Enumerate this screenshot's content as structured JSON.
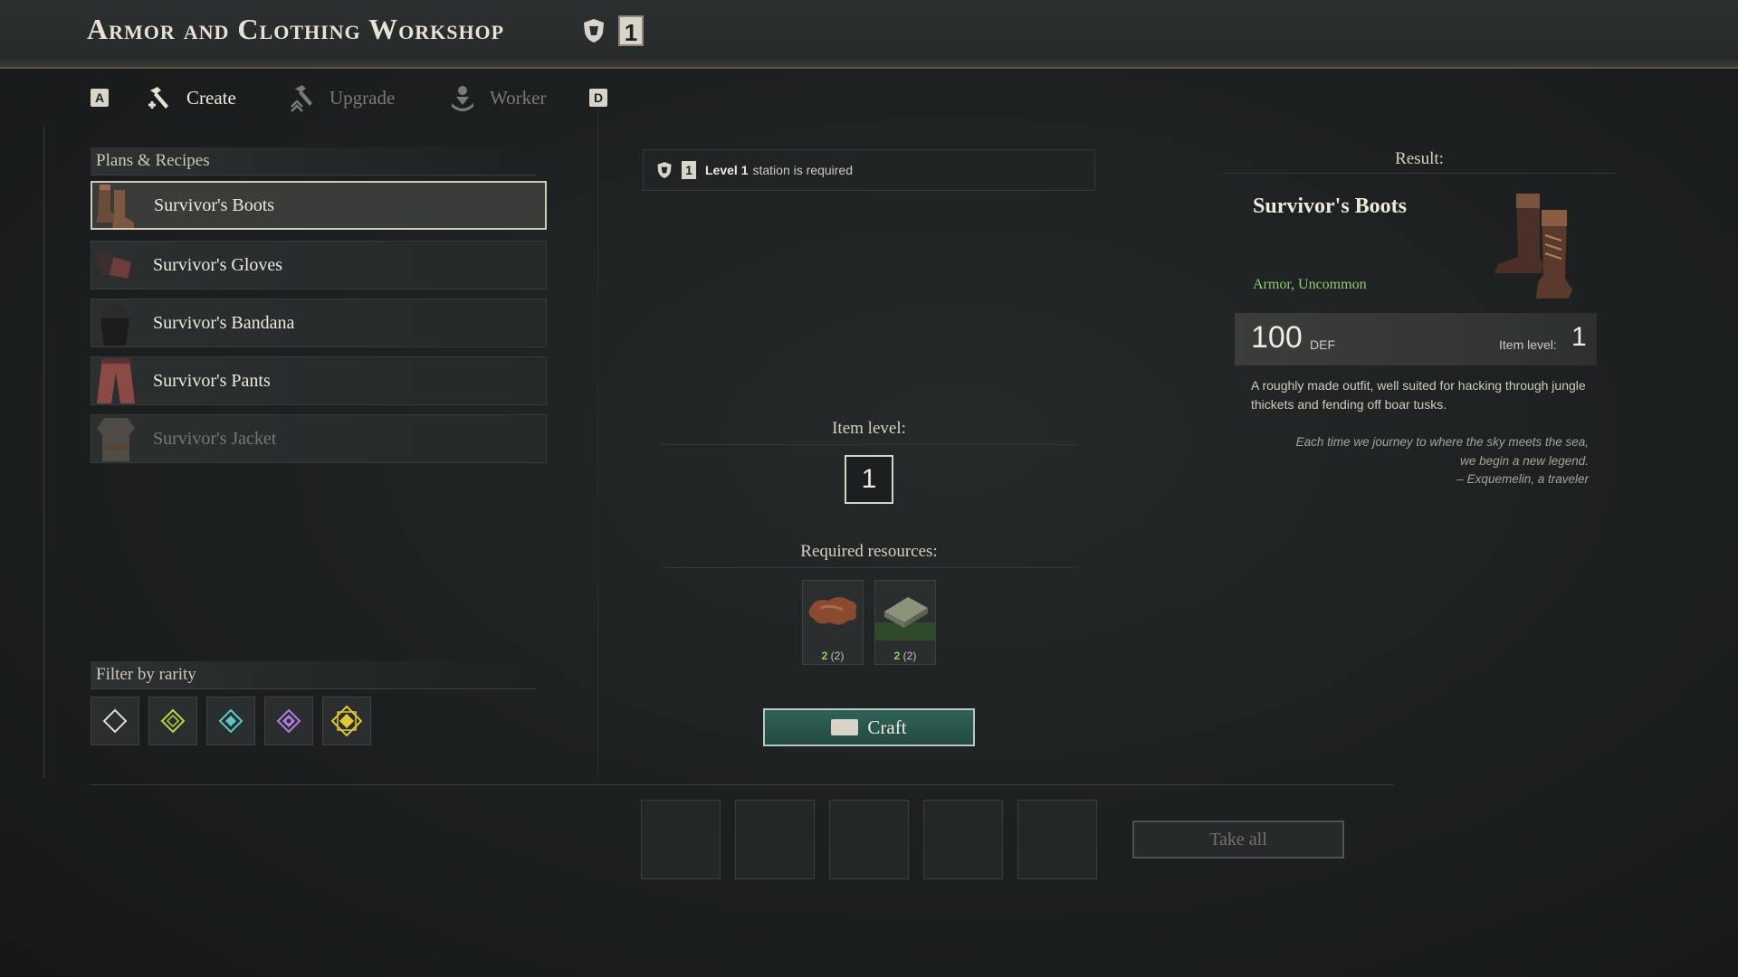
{
  "header": {
    "title": "Armor and Clothing Workshop",
    "station_level": "1"
  },
  "tabs": {
    "left_key": "A",
    "right_key": "D",
    "items": [
      {
        "label": "Create",
        "icon": "hammer-icon",
        "active": true
      },
      {
        "label": "Upgrade",
        "icon": "upgrade-hammer-icon",
        "active": false
      },
      {
        "label": "Worker",
        "icon": "worker-icon",
        "active": false
      }
    ]
  },
  "recipes": {
    "label": "Plans & Recipes",
    "items": [
      {
        "name": "Survivor's Boots",
        "icon": "boots-icon",
        "selected": true,
        "locked": false
      },
      {
        "name": "Survivor's Gloves",
        "icon": "gloves-icon",
        "selected": false,
        "locked": false
      },
      {
        "name": "Survivor's Bandana",
        "icon": "bandana-icon",
        "selected": false,
        "locked": false
      },
      {
        "name": "Survivor's Pants",
        "icon": "pants-icon",
        "selected": false,
        "locked": false
      },
      {
        "name": "Survivor's Jacket",
        "icon": "jacket-icon",
        "selected": false,
        "locked": true
      }
    ]
  },
  "filter": {
    "label": "Filter by rarity",
    "items": [
      {
        "name": "common",
        "color": "#e0dcd2"
      },
      {
        "name": "uncommon",
        "color": "#b9d24a"
      },
      {
        "name": "rare",
        "color": "#5fc7c9"
      },
      {
        "name": "epic",
        "color": "#b27ce0"
      },
      {
        "name": "legendary",
        "color": "#e2c63a"
      }
    ]
  },
  "center": {
    "requirement_level": "Level 1",
    "requirement_text": "station is required",
    "requirement_badge": "1",
    "item_level_label": "Item level:",
    "item_level_value": "1",
    "resources_label": "Required resources:",
    "resources": [
      {
        "name": "hide",
        "icon": "hide-icon",
        "have": "2",
        "need": "(2)"
      },
      {
        "name": "cloth",
        "icon": "cloth-icon",
        "have": "2",
        "need": "(2)"
      }
    ],
    "craft_label": "Craft"
  },
  "output": {
    "slots": 5,
    "take_all_label": "Take all"
  },
  "result": {
    "label": "Result:",
    "name": "Survivor's Boots",
    "type": "Armor, Uncommon",
    "def_value": "100",
    "def_unit": "DEF",
    "item_level_label": "Item level:",
    "item_level_value": "1",
    "description": "A roughly made outfit, well suited for hacking through jungle thickets and fending off boar tusks.",
    "quote_lines": [
      "Each time we journey to where the sky meets the sea,",
      "we begin a new legend.",
      "– Exquemelin, a traveler"
    ]
  },
  "colors": {
    "accent_green": "#8fd06b",
    "craft_button": "#2f6257",
    "selected_border": "#cfc9b8"
  }
}
